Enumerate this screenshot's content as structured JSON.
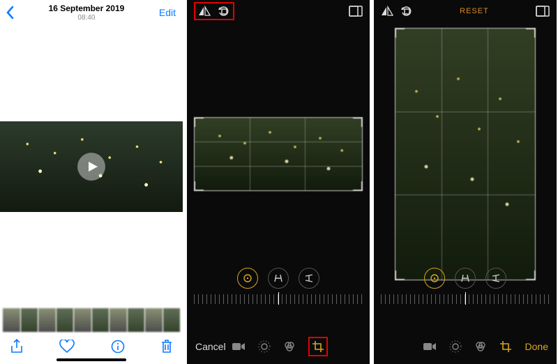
{
  "panel1": {
    "header": {
      "date": "16 September 2019",
      "time": "08:40",
      "edit_label": "Edit"
    },
    "toolbar": {
      "share_icon": "share-icon",
      "favorite_icon": "heart-icon",
      "info_icon": "info-icon",
      "trash_icon": "trash-icon"
    }
  },
  "panel2": {
    "topbar": {
      "flip_icon": "flip-horizontal-icon",
      "rotate_icon": "rotate-icon",
      "aspect_icon": "aspect-ratio-icon"
    },
    "bottombar": {
      "cancel_label": "Cancel",
      "modes": [
        "video",
        "adjust",
        "filters",
        "crop"
      ],
      "active_mode": "crop"
    },
    "highlight_top": true,
    "highlight_crop": true
  },
  "panel3": {
    "topbar": {
      "flip_icon": "flip-horizontal-icon",
      "rotate_icon": "rotate-icon",
      "reset_label": "RESET",
      "aspect_icon": "aspect-ratio-icon"
    },
    "bottombar": {
      "done_label": "Done",
      "modes": [
        "video",
        "adjust",
        "filters",
        "crop"
      ],
      "active_mode": "crop"
    }
  },
  "colors": {
    "ios_blue": "#0a7aff",
    "highlight_red": "#e40000",
    "accent_gold": "#d9a61e"
  }
}
